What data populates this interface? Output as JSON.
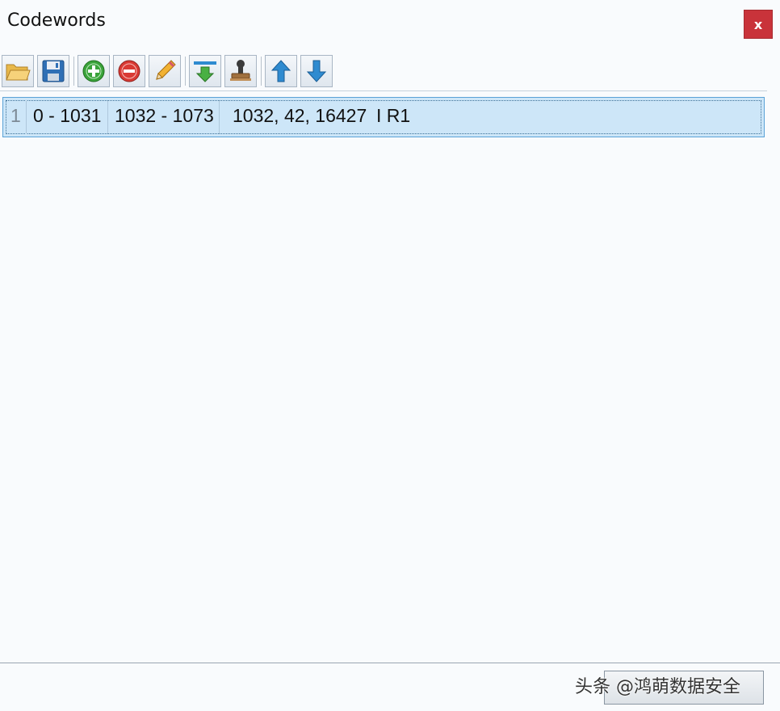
{
  "window": {
    "title": "Codewords",
    "close_label": "x"
  },
  "toolbar": {
    "buttons": [
      {
        "icon": "open-folder-icon"
      },
      {
        "icon": "save-icon"
      },
      {
        "icon": "add-icon"
      },
      {
        "icon": "remove-icon"
      },
      {
        "icon": "edit-icon"
      },
      {
        "icon": "import-icon"
      },
      {
        "icon": "stamp-icon"
      },
      {
        "icon": "move-up-icon"
      },
      {
        "icon": "move-down-icon"
      }
    ]
  },
  "list": {
    "rows": [
      {
        "index": "1",
        "range1": "0 - 1031",
        "range2": "1032 - 1073",
        "params": "1032, 42, 16427",
        "label": "I R1"
      }
    ]
  },
  "watermark": "头条 @鸿萌数据安全",
  "colors": {
    "selection": "#cde6f8",
    "selection_border": "#5aa2d6",
    "close": "#c9333a"
  }
}
